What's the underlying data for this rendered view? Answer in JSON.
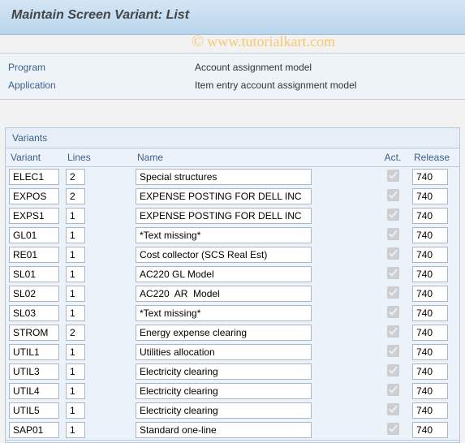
{
  "title": "Maintain Screen Variant: List",
  "watermark": {
    "symbol": "©",
    "text": "www.tutorialkart.com"
  },
  "info": {
    "program_label": "Program",
    "program_value": "Account assignment model",
    "application_label": "Application",
    "application_value": "Item entry account assignment model"
  },
  "variants_section_label": "Variants",
  "columns": {
    "variant": "Variant",
    "lines": "Lines",
    "name": "Name",
    "act": "Act.",
    "release": "Release"
  },
  "rows": [
    {
      "variant": "ELEC1",
      "lines": "2",
      "name": "Special structures",
      "act": true,
      "release": "740"
    },
    {
      "variant": "EXPOS",
      "lines": "2",
      "name": "EXPENSE POSTING FOR DELL INC",
      "act": true,
      "release": "740"
    },
    {
      "variant": "EXPS1",
      "lines": "1",
      "name": "EXPENSE POSTING FOR DELL INC",
      "act": true,
      "release": "740"
    },
    {
      "variant": "GL01",
      "lines": "1",
      "name": "*Text missing*",
      "act": true,
      "release": "740"
    },
    {
      "variant": "RE01",
      "lines": "1",
      "name": "Cost collector (SCS Real Est)",
      "act": true,
      "release": "740"
    },
    {
      "variant": "SL01",
      "lines": "1",
      "name": "AC220 GL Model",
      "act": true,
      "release": "740"
    },
    {
      "variant": "SL02",
      "lines": "1",
      "name": "AC220  AR  Model",
      "act": true,
      "release": "740"
    },
    {
      "variant": "SL03",
      "lines": "1",
      "name": "*Text missing*",
      "act": true,
      "release": "740"
    },
    {
      "variant": "STROM",
      "lines": "2",
      "name": "Energy expense clearing",
      "act": true,
      "release": "740"
    },
    {
      "variant": "UTIL1",
      "lines": "1",
      "name": "Utilities allocation",
      "act": true,
      "release": "740"
    },
    {
      "variant": "UTIL3",
      "lines": "1",
      "name": "Electricity clearing",
      "act": true,
      "release": "740"
    },
    {
      "variant": "UTIL4",
      "lines": "1",
      "name": "Electricity clearing",
      "act": true,
      "release": "740"
    },
    {
      "variant": "UTIL5",
      "lines": "1",
      "name": "Electricity clearing",
      "act": true,
      "release": "740"
    },
    {
      "variant": "SAP01",
      "lines": "1",
      "name": "Standard one-line",
      "act": true,
      "release": "740"
    }
  ]
}
